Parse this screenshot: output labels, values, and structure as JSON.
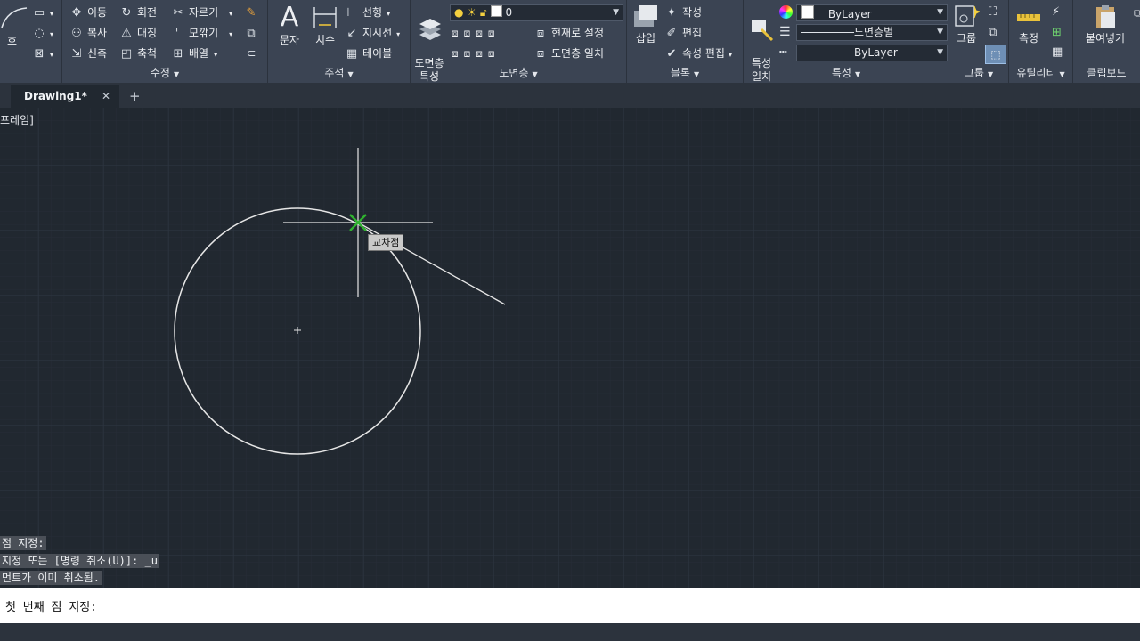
{
  "ribbon": {
    "draw": {
      "arc_label": "호"
    },
    "modify": {
      "label": "수정",
      "move": "이동",
      "rotate": "회전",
      "trim": "자르기",
      "copy": "복사",
      "mirror": "대칭",
      "fillet": "모깎기",
      "stretch": "신축",
      "scale": "축척",
      "array": "배열"
    },
    "annotation": {
      "label": "주석",
      "text": "문자",
      "dimension": "치수",
      "linear": "선형",
      "leader": "지시선",
      "table": "테이블"
    },
    "layers": {
      "label": "도면층",
      "layer_properties": "도면층\n특성",
      "current_layer": "0",
      "make_current": "현재로 설정",
      "match_layer": "도면층 일치"
    },
    "block": {
      "label": "블록",
      "insert": "삽입",
      "create": "작성",
      "edit": "편집",
      "edit_attributes": "속성 편집"
    },
    "properties": {
      "label": "특성",
      "match_properties": "특성\n일치",
      "color": "ByLayer",
      "lineweight": "도면층별",
      "linetype": "ByLayer"
    },
    "groups": {
      "label": "그룹",
      "group": "그룹"
    },
    "utilities": {
      "label": "유틸리티",
      "measure": "측정"
    },
    "clipboard": {
      "label": "클립보드",
      "paste": "붙여넣기"
    }
  },
  "tabs": {
    "active": "Drawing1*",
    "close": "✕",
    "new": "+"
  },
  "viewport_label": "프레임]",
  "canvas": {
    "osnap_tooltip": "교차점"
  },
  "command_history": [
    "점 지정:",
    "지정 또는 [명령 취소(U)]: _u",
    "먼트가 이미 취소됨."
  ],
  "command_prompt": "첫 번째 점 지정:",
  "colors": {
    "background": "#212830",
    "ribbon": "#3b4453",
    "snap_marker": "#2fb32f",
    "geometry": "#e6e6e6"
  }
}
